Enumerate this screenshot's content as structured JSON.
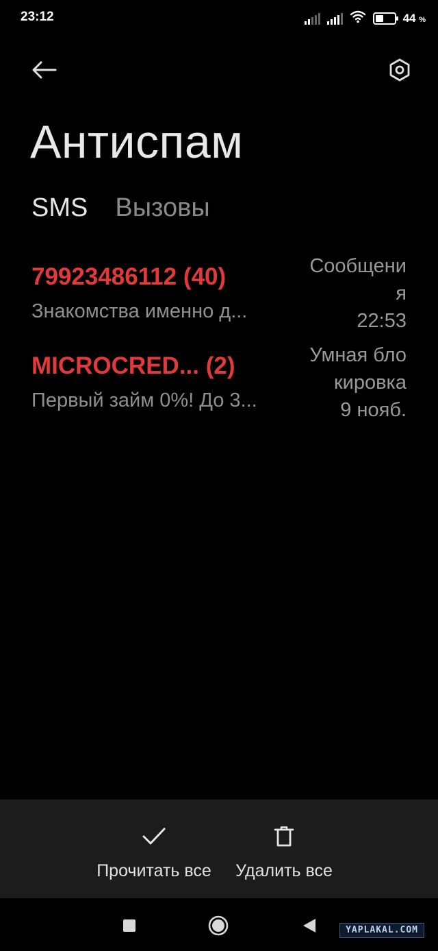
{
  "status_bar": {
    "time": "23:12",
    "battery_percent": "44",
    "battery_unit": "%",
    "battery_level": 0.44,
    "icons": [
      "signal-icon",
      "signal-icon",
      "wifi-icon",
      "battery-icon"
    ]
  },
  "toolbar": {
    "back_icon": "back-arrow-icon",
    "settings_icon": "settings-gear-icon"
  },
  "page": {
    "title": "Антиспам"
  },
  "tabs": [
    {
      "label": "SMS",
      "active": true
    },
    {
      "label": "Вызовы",
      "active": false
    }
  ],
  "messages": [
    {
      "sender": "79923486112 (40)",
      "preview": "Знакомства именно д...",
      "meta_line1": "Сообщени",
      "meta_line2": "я",
      "meta_line3": "22:53"
    },
    {
      "sender": "MICROCRED... (2)",
      "preview": "Первый займ 0%! До 3...",
      "meta_line1": "Умная бло",
      "meta_line2": "кировка",
      "meta_line3": "9 нояб."
    }
  ],
  "actions": {
    "read_all_label": "Прочитать все",
    "delete_all_label": "Удалить все"
  },
  "colors": {
    "sender_red": "#e23a3a",
    "background": "#000000",
    "action_bar": "#1c1c1c"
  },
  "watermark": {
    "text": "YAPLAKAL.COM"
  }
}
